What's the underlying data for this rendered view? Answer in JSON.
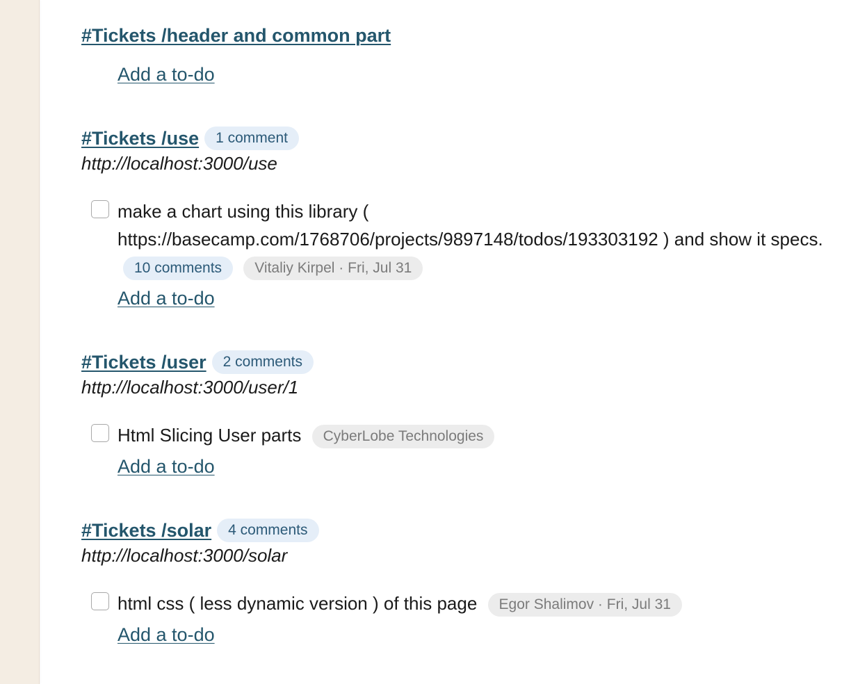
{
  "lists": [
    {
      "title": "#Tickets /header and common part",
      "add_todo": "Add a to-do"
    },
    {
      "title": "#Tickets /use ",
      "comments": "1 comment",
      "description": "http://localhost:3000/use",
      "todo": {
        "text": "make a chart using this library ( https://basecamp.com/1768706/projects/9897148/todos/193303192 ) and show it specs.",
        "comments": "10 comments",
        "meta": "Vitaliy Kirpel · Fri, Jul 31"
      },
      "add_todo": "Add a to-do"
    },
    {
      "title": "#Tickets /user ",
      "comments": "2 comments",
      "description": "http://localhost:3000/user/1",
      "todo": {
        "text": "Html Slicing User parts",
        "meta": "CyberLobe Technologies"
      },
      "add_todo": "Add a to-do"
    },
    {
      "title": "#Tickets /solar ",
      "comments": "4 comments",
      "description": "http://localhost:3000/solar",
      "todo": {
        "text": "html css ( less dynamic version ) of this page",
        "meta": "Egor Shalimov · Fri, Jul 31"
      },
      "add_todo": "Add a to-do"
    }
  ]
}
